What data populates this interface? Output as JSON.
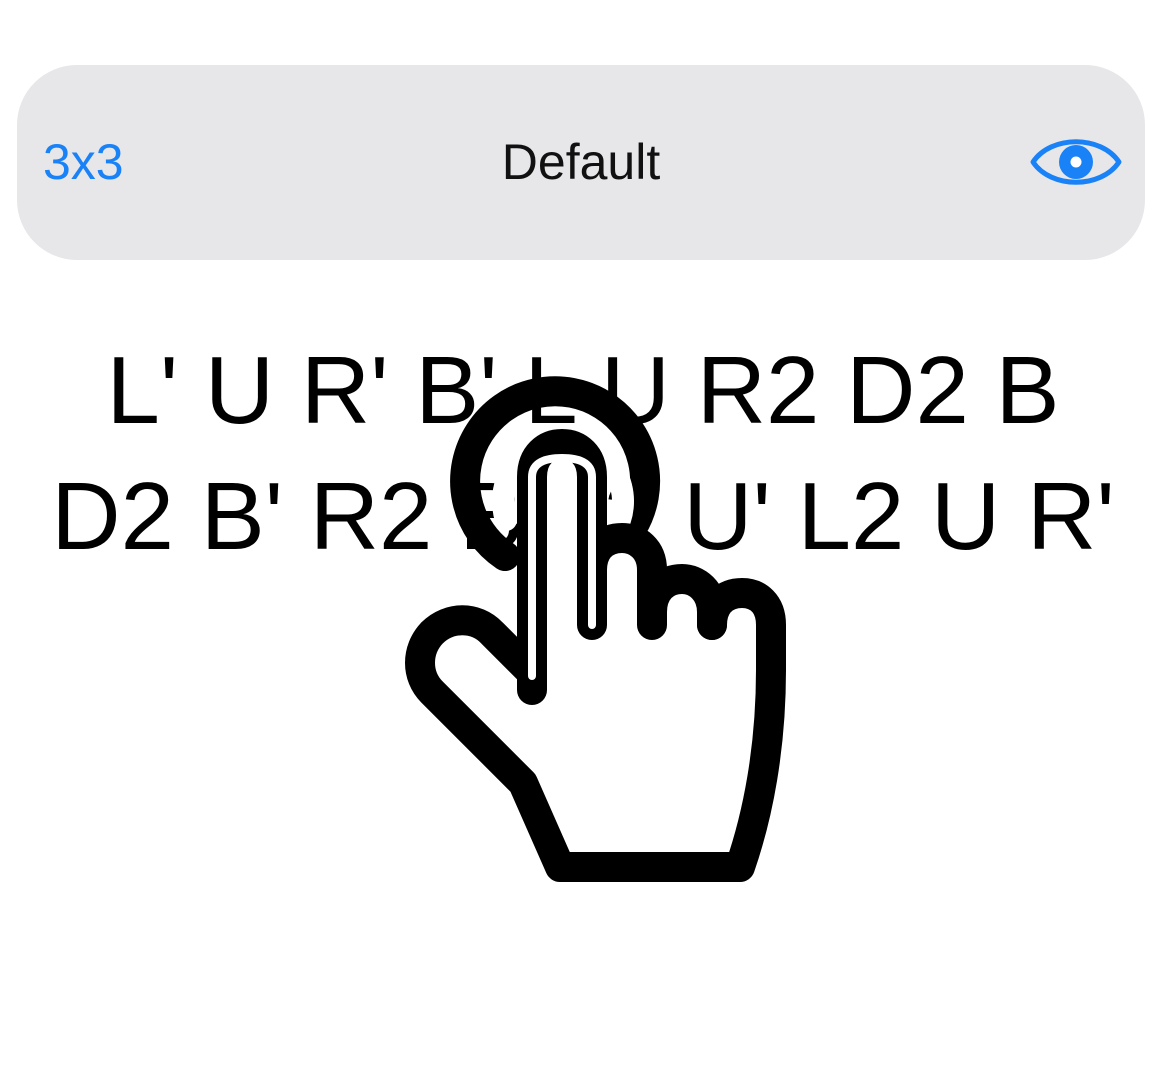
{
  "toolbar": {
    "puzzle_label": "3x3",
    "session_title": "Default",
    "toggle_icon": "eye-icon",
    "accent_color": "#1a82f7",
    "background_color": "#e7e7ea"
  },
  "scramble": {
    "line_1": "L' U R' B' L U R2 D2 B",
    "line_2": "D2 B' R2 B L2 U' L2 U R'"
  },
  "overlay": {
    "icon": "tap-hand-icon"
  }
}
